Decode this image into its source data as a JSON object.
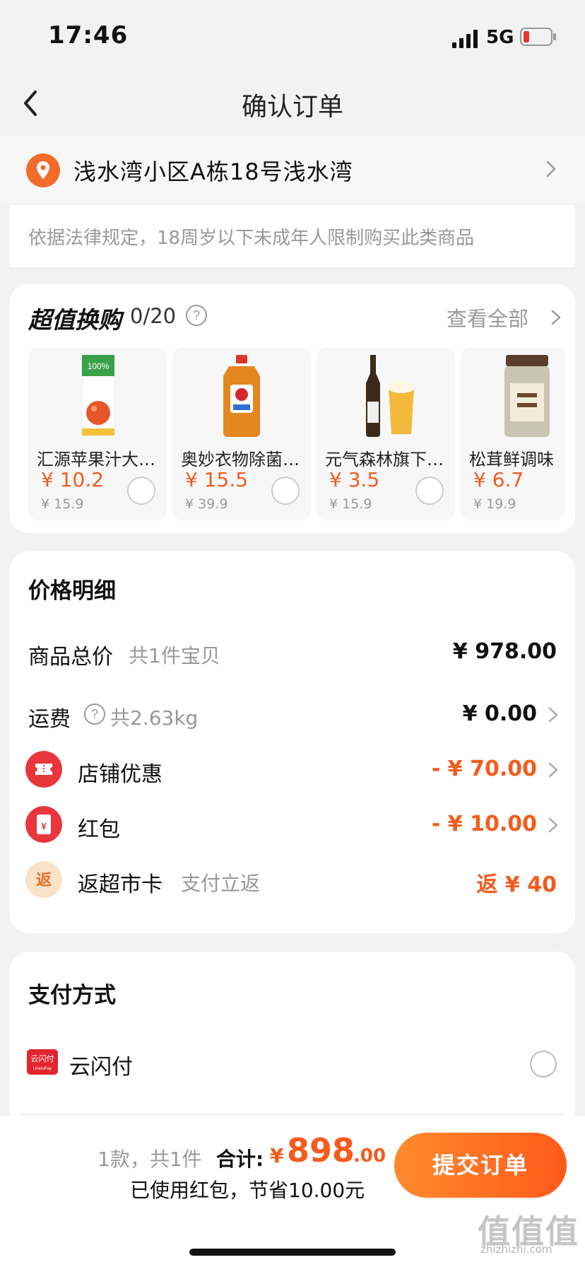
{
  "status_bar": {
    "time": "17:46",
    "network": "5G"
  },
  "nav": {
    "title": "确认订单"
  },
  "address": {
    "text": "浅水湾小区A栋18号浅水湾"
  },
  "notice": {
    "text": "依据法律规定，18周岁以下未成年人限制购买此类商品"
  },
  "swap": {
    "title": "超值换购",
    "count": "0/20",
    "view_all": "查看全部",
    "products": [
      {
        "name": "汇源苹果汁大…",
        "price": "¥ 10.2",
        "original": "¥ 15.9",
        "image": "apple-juice-carton"
      },
      {
        "name": "奥妙衣物除菌…",
        "price": "¥ 15.5",
        "original": "¥ 39.9",
        "image": "disinfectant-bottle"
      },
      {
        "name": "元气森林旗下…",
        "price": "¥ 3.5",
        "original": "¥ 15.9",
        "image": "beer-bottle-glass"
      },
      {
        "name": "松茸鲜调味",
        "price": "¥ 6.7",
        "original": "¥ 19.9",
        "image": "seasoning-jar"
      }
    ]
  },
  "price_detail": {
    "heading": "价格明细",
    "goods_total": {
      "label": "商品总价",
      "sub": "共1件宝贝",
      "value": "¥ 978.00"
    },
    "shipping": {
      "label": "运费",
      "sub": "共2.63kg",
      "value": "¥ 0.00"
    },
    "store_discount": {
      "label": "店铺优惠",
      "value": "- ¥ 70.00"
    },
    "red_packet": {
      "label": "红包",
      "value": "- ¥ 10.00",
      "icon_char": "¥"
    },
    "cashback": {
      "label": "返超市卡",
      "sub": "支付立返",
      "value": "返 ¥ 40",
      "icon_char": "返"
    }
  },
  "payment": {
    "heading": "支付方式",
    "method": "云闪付",
    "logo_text": "云闪付",
    "logo_sub": "UnionPay"
  },
  "bottom": {
    "count": "1款，共1件",
    "total_label": "合计:",
    "currency": "¥",
    "total_int": "898",
    "total_dec": ".00",
    "saving": "已使用红包，节省10.00元",
    "submit": "提交订单"
  },
  "watermark": {
    "text": "值值值",
    "sub": "zhizhizhi.com"
  },
  "colors": {
    "accent": "#f35c1d",
    "button_start": "#ff8a2d",
    "button_end": "#ff5a1a",
    "discount_red": "#e8363c"
  }
}
